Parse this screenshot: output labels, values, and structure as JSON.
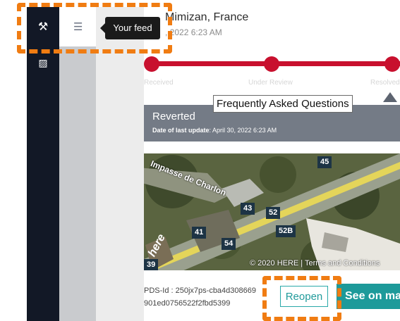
{
  "sidebar": {
    "top_icon": "tools-icon",
    "second_icon": "map-grid-icon",
    "list_icon": "list-icon",
    "tooltip": "Your feed"
  },
  "report": {
    "address": "Mimizan, France",
    "date_fragment": ", 2022 6:23 AM",
    "steps": [
      "Received",
      "Under Review",
      "Resolved"
    ],
    "status_title": "Reverted",
    "date_label": "Date of last update",
    "date_value": ": April 30, 2022 6:23 AM",
    "faq_tooltip": "Frequently Asked Questions"
  },
  "map": {
    "street": "Impasse de Charlon",
    "labels": [
      "45",
      "43",
      "52",
      "41",
      "54",
      "52B",
      "39"
    ],
    "logo": "here",
    "copyright": "© 2020 HERE | Terms and Conditions"
  },
  "footer": {
    "pds_line1": "PDS-Id : 250jx7ps-cba4d308669",
    "pds_line2": "901ed0756522f2fbd5399",
    "reopen": "Reopen",
    "see_on_map": "See on map"
  },
  "colors": {
    "accent": "#c8102e",
    "teal": "#1d9a9a",
    "highlight": "#f07c12"
  }
}
